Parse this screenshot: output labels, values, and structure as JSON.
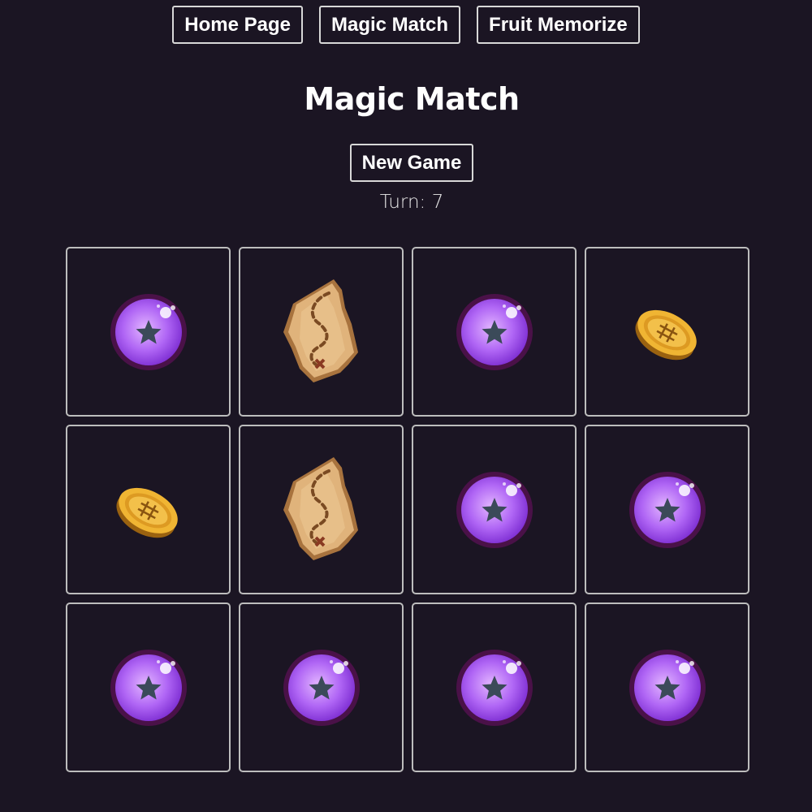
{
  "nav": {
    "items": [
      {
        "label": "Home Page"
      },
      {
        "label": "Magic Match"
      },
      {
        "label": "Fruit Memorize"
      }
    ]
  },
  "game": {
    "title": "Magic Match",
    "new_game_label": "New Game",
    "turn_text": "Turn: 7"
  },
  "board": {
    "rows": 3,
    "columns": 4,
    "cards": [
      {
        "icon": "magic-orb-icon"
      },
      {
        "icon": "treasure-map-icon"
      },
      {
        "icon": "magic-orb-icon"
      },
      {
        "icon": "gold-coin-icon"
      },
      {
        "icon": "gold-coin-icon"
      },
      {
        "icon": "treasure-map-icon"
      },
      {
        "icon": "magic-orb-icon"
      },
      {
        "icon": "magic-orb-icon"
      },
      {
        "icon": "magic-orb-icon"
      },
      {
        "icon": "magic-orb-icon"
      },
      {
        "icon": "magic-orb-icon"
      },
      {
        "icon": "magic-orb-icon"
      }
    ]
  },
  "colors": {
    "background": "#1b1523",
    "orb": "#a24ff0",
    "coin": "#e3a52a",
    "map": "#d9a66a"
  }
}
